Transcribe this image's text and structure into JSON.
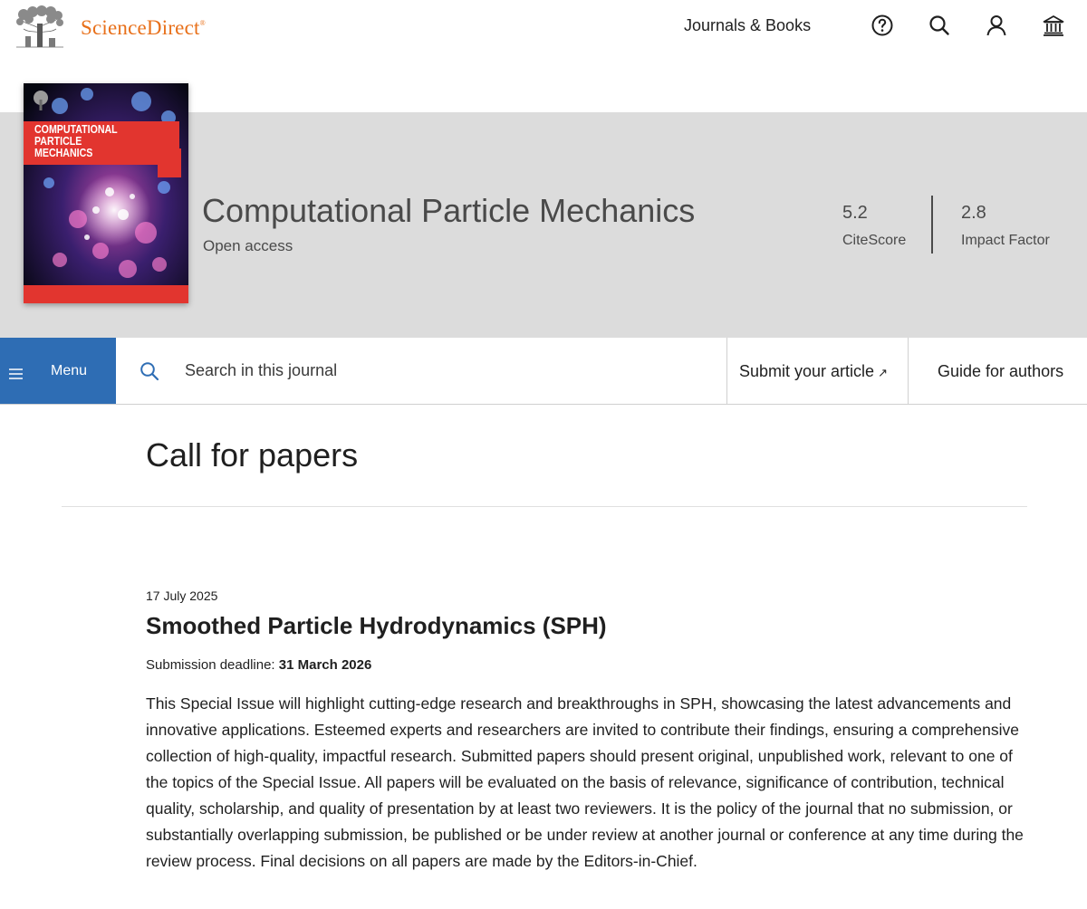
{
  "topbar": {
    "brand": "ScienceDirect",
    "brand_mark": "®",
    "journals_link": "Journals & Books",
    "icons": [
      "help-icon",
      "search-icon",
      "user-icon",
      "institution-icon"
    ]
  },
  "journal": {
    "title": "Computational Particle Mechanics",
    "access": "Open access",
    "cover_title": "Computational Particle Mechanics",
    "metrics": [
      {
        "value": "5.2",
        "label": "CiteScore"
      },
      {
        "value": "2.8",
        "label": "Impact Factor"
      }
    ]
  },
  "journal_nav": {
    "menu_label": "Menu",
    "search_placeholder": "Search in this journal",
    "submit_label": "Submit your article",
    "submit_icon": "↗",
    "guide_label": "Guide for authors"
  },
  "content": {
    "page_title": "Call for papers",
    "cfp": {
      "date": "17 July 2025",
      "title": "Smoothed Particle Hydrodynamics (SPH)",
      "deadline_label": "Submission deadline:",
      "deadline_value": "31 March 2026",
      "body": "This Special Issue will highlight cutting-edge research and breakthroughs in SPH, showcasing the latest advancements and innovative applications. Esteemed experts and researchers are invited to contribute their findings, ensuring a comprehensive collection of high-quality, impactful research. Submitted papers should present original, unpublished work, relevant to one of the topics of the Special Issue. All papers will be evaluated on the basis of relevance, significance of contribution, technical quality, scholarship, and quality of presentation by at least two reviewers. It is the policy of the journal that no submission, or substantially overlapping submission, be published or be under review at another journal or conference at any time during the review process. Final decisions on all papers are made by the Editors-in-Chief."
    }
  },
  "colors": {
    "brand_orange": "#e8701a",
    "menu_blue": "#2e6db4",
    "band_gray": "#dcdcdc",
    "cover_red": "#e2352f"
  }
}
